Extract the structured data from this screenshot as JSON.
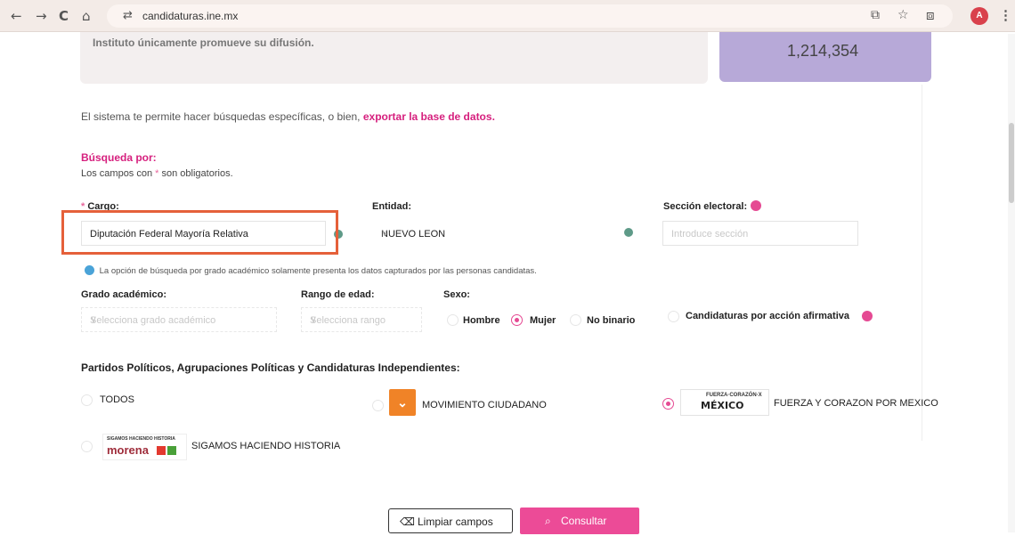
{
  "browser": {
    "url": "candidaturas.ine.mx",
    "profile_initial": "A"
  },
  "banner": {
    "left_text": "Instituto únicamente promueve su difusión.",
    "count": "1,214,354"
  },
  "intro": {
    "text": "El sistema te permite hacer búsquedas específicas, o bien,",
    "link": "exportar la base de datos."
  },
  "search": {
    "title": "Búsqueda por:",
    "required_prefix": "Los campos con",
    "required_star": "*",
    "required_suffix": "son obligatorios."
  },
  "fields": {
    "cargo": {
      "star": "*",
      "label": "Cargo:",
      "value": "Diputación Federal Mayoría Relativa"
    },
    "entidad": {
      "label": "Entidad:",
      "value": "NUEVO LEON"
    },
    "seccion": {
      "label": "Sección electoral:",
      "placeholder": "Introduce sección"
    }
  },
  "info_text": "La opción de búsqueda por grado académico solamente presenta los datos capturados por las personas candidatas.",
  "filters": {
    "grado": {
      "label": "Grado académico:",
      "placeholder": "Selecciona grado académico"
    },
    "edad": {
      "label": "Rango de edad:",
      "placeholder": "Selecciona rango"
    },
    "sexo": {
      "label": "Sexo:",
      "options": [
        "Hombre",
        "Mujer",
        "No binario"
      ],
      "selected": "Mujer"
    },
    "afirmativa": "Candidaturas por acción afirmativa"
  },
  "parties": {
    "title": "Partidos Políticos, Agrupaciones Políticas y Candidaturas Independientes:",
    "todos": "TODOS",
    "mc": "MOVIMIENTO CIUDADANO",
    "fcm": "FUERZA Y CORAZON POR MEXICO",
    "fcm_logo_top": "FUERZA·CORAZÓN·X",
    "fcm_logo_main": "MÉXICO",
    "sigamos": "SIGAMOS HACIENDO HISTORIA",
    "morena_logo_top": "SIGAMOS HACIENDO HISTORIA",
    "morena_logo_main": "morena",
    "selected": "FUERZA Y CORAZON POR MEXICO"
  },
  "buttons": {
    "clear": "Limpiar campos",
    "search": "Consultar"
  },
  "colors": {
    "accent": "#ec4b97",
    "highlight": "#e5603a",
    "banner_purple": "#b7a9d8"
  },
  "icons": {
    "back": "←",
    "forward": "→",
    "reload": "C",
    "home": "⌂",
    "tune": "⇄",
    "star": "☆",
    "share": "⧉",
    "chev": "∨",
    "calendar": "🗓",
    "search": "⌕",
    "eraser": "⌫"
  }
}
